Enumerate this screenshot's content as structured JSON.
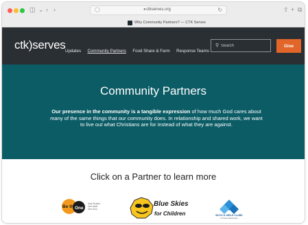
{
  "browser": {
    "url": "ctkserves.org",
    "tab_title": "Why Community Partners? — CTK Serves"
  },
  "header": {
    "logo_left": "ctk",
    "logo_right": "serves",
    "nav": [
      "Updates",
      "Community Partners",
      "Food Share & Farm",
      "Response Teams"
    ],
    "search_placeholder": "Search",
    "give_label": "Give"
  },
  "hero": {
    "title": "Community Partners",
    "text_bold": "Our presence in the community is a tangible expression",
    "text_rest": " of how much God cares about many of the same things that our community does. In relationship and shared work, we want to live out what Christians are for instead of what they are against."
  },
  "partners": {
    "heading": "Click on a Partner to learn more",
    "logos": [
      {
        "name": "Be the One",
        "tagline": "Kids Student One Adult One Hour"
      },
      {
        "name": "Blue Skies for Children"
      },
      {
        "name": "Boys & Girls Clubs",
        "tagline": "of Greater Washington"
      }
    ]
  },
  "colors": {
    "header_bg": "#2a2f33",
    "hero_bg": "#0c5c66",
    "give_button": "#e2662a"
  }
}
